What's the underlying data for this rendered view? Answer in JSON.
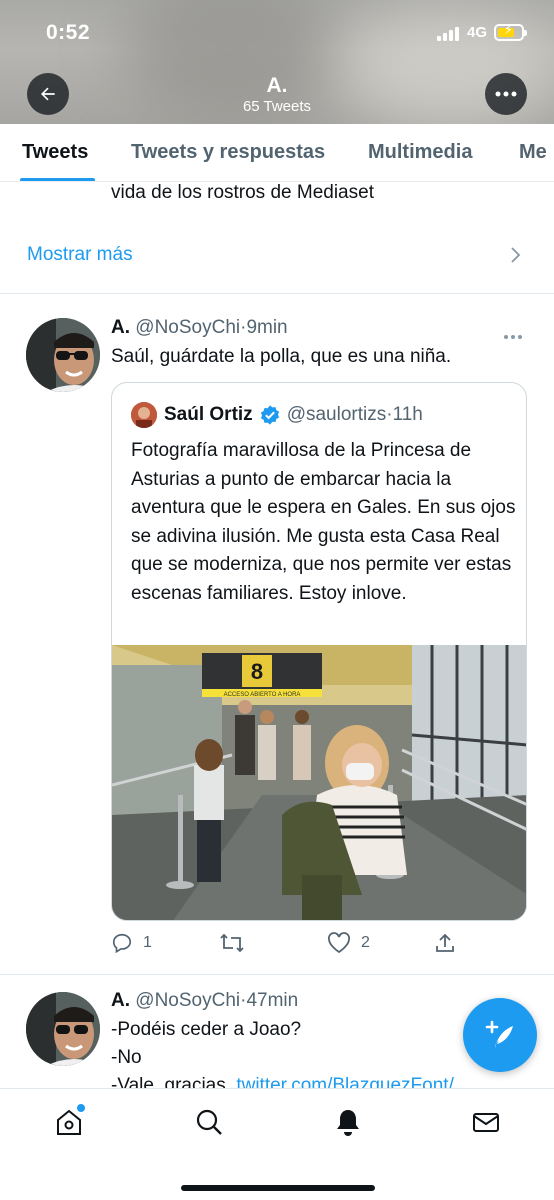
{
  "status_bar": {
    "time": "0:52",
    "network": "4G"
  },
  "profile": {
    "name": "A.",
    "tweet_count": "65 Tweets"
  },
  "tabs": [
    {
      "label": "Tweets",
      "active": true
    },
    {
      "label": "Tweets y respuestas",
      "active": false
    },
    {
      "label": "Multimedia",
      "active": false
    },
    {
      "label": "Me",
      "active": false
    }
  ],
  "previous_tweet": {
    "text_tail": "vida de los rostros de Mediaset",
    "show_more": "Mostrar más"
  },
  "tweet1": {
    "name": "A.",
    "handle": "@NoSoyChi",
    "separator": "·",
    "time": "9min",
    "text": "Saúl, guárdate la polla, que es una niña.",
    "quote": {
      "name": "Saúl Ortiz",
      "handle": "@saulortizs",
      "separator": "·",
      "time": "11h",
      "text": "Fotografía maravillosa de la Princesa de Asturias a punto de embarcar hacia la aventura que le espera en Gales. En sus ojos se adivina ilusión. Me gusta esta Casa Real que se moderniza, que nos permite ver estas escenas familiares. Estoy inlove.",
      "photo_sign_number": "8",
      "photo_sign_text": "ACCESO ABIERTO A HORA"
    },
    "replies": "1",
    "retweets": "",
    "likes": "2"
  },
  "tweet2": {
    "name": "A.",
    "handle": "@NoSoyChi",
    "separator": "·",
    "time": "47min",
    "line1": "-Podéis ceder a Joao?",
    "line2": "-No",
    "line3_text": "-Vale, gracias. ",
    "line3_link": "twitter.com/BlazquezFont/"
  },
  "colors": {
    "accent": "#1d9bf0",
    "text": "#0f1419",
    "secondary": "#536471"
  },
  "icons": [
    "back-arrow-icon",
    "more-icon",
    "home-icon",
    "search-icon",
    "bell-icon",
    "mail-icon",
    "compose-icon",
    "reply-icon",
    "retweet-icon",
    "like-icon",
    "share-icon",
    "verified-icon"
  ]
}
